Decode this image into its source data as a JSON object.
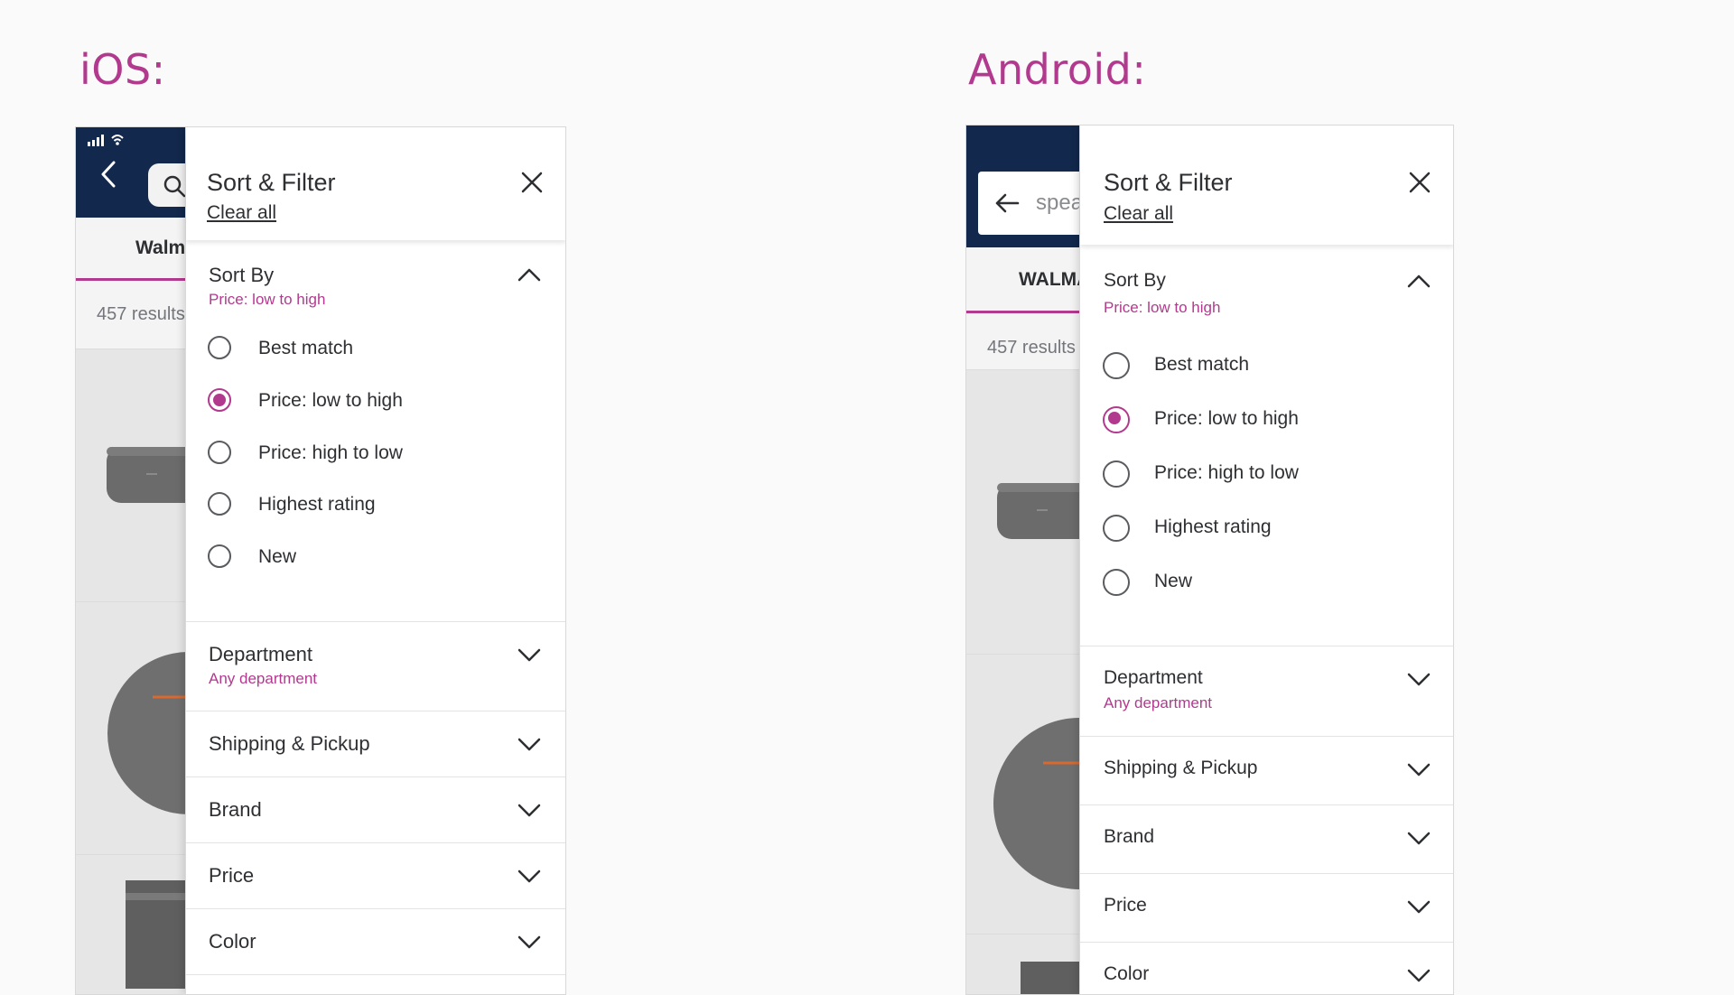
{
  "ios": {
    "heading": "iOS:",
    "tab_label": "Walm",
    "results_text": "457 results",
    "sheet": {
      "title": "Sort & Filter",
      "clear_all": "Clear all",
      "sort": {
        "title": "Sort By",
        "selected": "Price: low to high",
        "options": [
          "Best match",
          "Price: low to high",
          "Price: high to low",
          "Highest rating",
          "New"
        ],
        "checked_index": 1
      },
      "sections": [
        {
          "title": "Department",
          "subtitle": "Any department"
        },
        {
          "title": "Shipping & Pickup"
        },
        {
          "title": "Brand"
        },
        {
          "title": "Price"
        },
        {
          "title": "Color"
        }
      ]
    }
  },
  "android": {
    "heading": "Android:",
    "search_text": "spea",
    "tab_label": "WALMA",
    "results_text": "457 results",
    "sheet": {
      "title": "Sort & Filter",
      "clear_all": "Clear all",
      "sort": {
        "title": "Sort By",
        "selected": "Price: low to high",
        "options": [
          "Best match",
          "Price: low to high",
          "Price: high to low",
          "Highest rating",
          "New"
        ],
        "checked_index": 1
      },
      "sections": [
        {
          "title": "Department",
          "subtitle": "Any department"
        },
        {
          "title": "Shipping & Pickup"
        },
        {
          "title": "Brand"
        },
        {
          "title": "Price"
        },
        {
          "title": "Color"
        }
      ]
    }
  },
  "colors": {
    "accent": "#b23a8e",
    "navy": "#12284c",
    "text": "#2e2f32"
  }
}
